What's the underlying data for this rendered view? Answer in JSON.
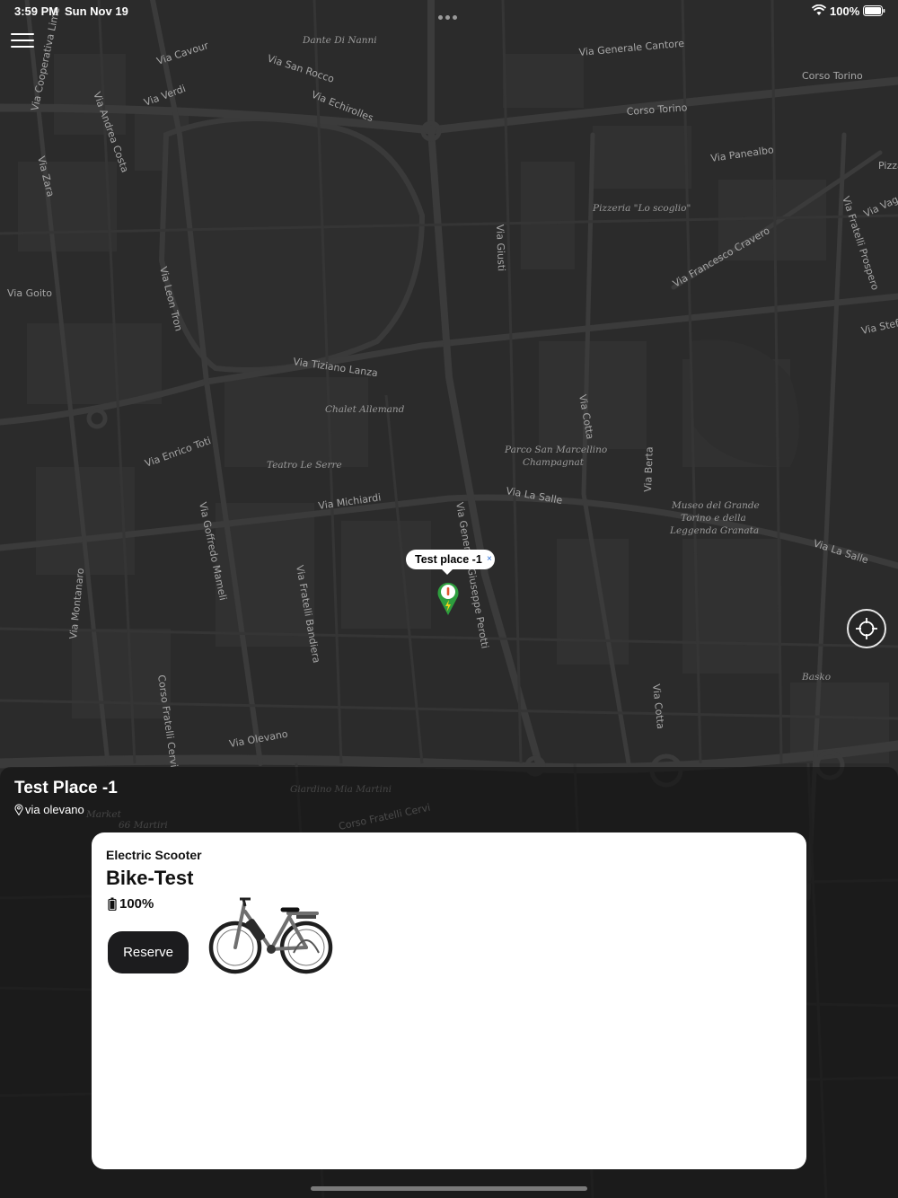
{
  "status_bar": {
    "time": "3:59 PM",
    "date": "Sun Nov 19",
    "battery_percent": "100%"
  },
  "map": {
    "labels": [
      "Dante Di Nanni",
      "Via Cavour",
      "Via San Rocco",
      "Via Verdi",
      "Via Echirolles",
      "Via Andrea Costa",
      "Via Cooperativa Lime",
      "Via Zara",
      "Via Generale Cantore",
      "Corso Torino",
      "Corso Torino",
      "Via Panealbo",
      "Pizzeria \"Lo scoglio\"",
      "Via Francesco Cravero",
      "Via Fratelli Prospero",
      "Via Vag",
      "Via Goito",
      "Via Leon Tron",
      "Via Giusti",
      "Via Tiziano Lanza",
      "Chalet Allemand",
      "Via Enrico Toti",
      "Teatro Le Serre",
      "Parco San Marcellino",
      "Champagnat",
      "Via La Salle",
      "Via Cotta",
      "Via Berta",
      "Museo del Grande",
      "Torino e della",
      "Leggenda Granata",
      "Via La Salle",
      "Via Michiardi",
      "Via Goffredo Mameli",
      "Via Fratelli Bandiera",
      "Via Montanaro",
      "Corso Fratelli Cervi",
      "Via Olevano",
      "Basko",
      "Via Cotta",
      "Giardino Mia Martini",
      "Corso Fratelli Cervi",
      "Via Stefa",
      "Pizza",
      "Market",
      "66 Martiri",
      "Via Generale Giuseppe Perotti"
    ],
    "pin_callout": "Test place -1",
    "callout_close": "×",
    "pin_icon": "green-charging-pin",
    "pin_color": "#2e9e3e"
  },
  "place": {
    "title": "Test Place -1",
    "address": "via olevano"
  },
  "vehicle": {
    "type": "Electric Scooter",
    "name": "Bike-Test",
    "battery": "100%",
    "battery_level": 1.0,
    "reserve_label": "Reserve",
    "image": "e-bike-photo"
  },
  "colors": {
    "map_background": "#2a2a2a",
    "panel": "#121212",
    "button_dark": "#1c1c1e",
    "card": "#ffffff"
  }
}
